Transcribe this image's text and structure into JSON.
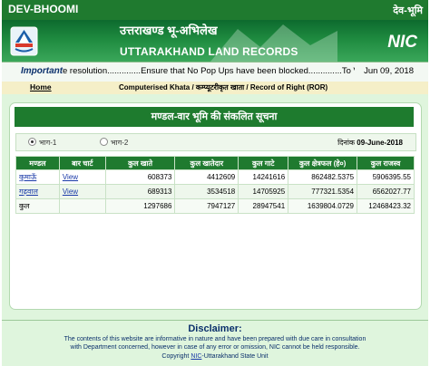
{
  "header": {
    "brand": "DEV-BHOOMI",
    "lang_link": "देव-भूमि",
    "title_hi": "उत्तराखण्ड भू-अभिलेख",
    "title_en": "UTTARAKHAND LAND RECORDS",
    "nic": "NIC"
  },
  "notice": {
    "label": "Important",
    "message": "e resolution..............Ensure that No Pop Ups have been blocked..............To View",
    "date": "Jun 09, 2018"
  },
  "nav": {
    "home": "Home",
    "breadcrumb": "Computerised Khata / कम्प्यूटरीकृत खाता / Record of Right (ROR)"
  },
  "panel": {
    "title": "मण्डल-वार भूमि की संकलित सूचना",
    "option1": "भाग-1",
    "option2": "भाग-2",
    "date_label": "दिनांक",
    "date_value": "09-June-2018"
  },
  "table": {
    "headers": [
      "मण्डल",
      "बार चार्ट",
      "कुल खाते",
      "कुल खातेदार",
      "कुल गाटे",
      "कुल क्षेत्रफल (हे०)",
      "कुल राजस्व"
    ],
    "rows": [
      {
        "mandal": "कुमाऊँ",
        "chart": "View",
        "khate": "608373",
        "khatedar": "4412609",
        "gate": "14241616",
        "area": "862482.5375",
        "rajaswa": "5906395.55"
      },
      {
        "mandal": "गढ़वाल",
        "chart": "View",
        "khate": "689313",
        "khatedar": "3534518",
        "gate": "14705925",
        "area": "777321.5354",
        "rajaswa": "6562027.77"
      },
      {
        "mandal": "कुल",
        "chart": "",
        "khate": "1297686",
        "khatedar": "7947127",
        "gate": "28947541",
        "area": "1639804.0729",
        "rajaswa": "12468423.32"
      }
    ]
  },
  "footer": {
    "heading": "Disclaimer:",
    "text1": "The contents of this website are informative in nature and have been prepared with due care in consultation",
    "text2": "with Department concerned, however in case of any error or omission, NIC cannot be held responsible.",
    "copy_pre": "Copyright",
    "copy_link": "NIC",
    "copy_post": "-Uttarakhand State Unit"
  },
  "colors": {
    "header_green": "#1f7a2f",
    "link_blue": "#1a3aa8",
    "panel_bg": "#dff5dd",
    "nav_bg": "#f5efc8"
  }
}
